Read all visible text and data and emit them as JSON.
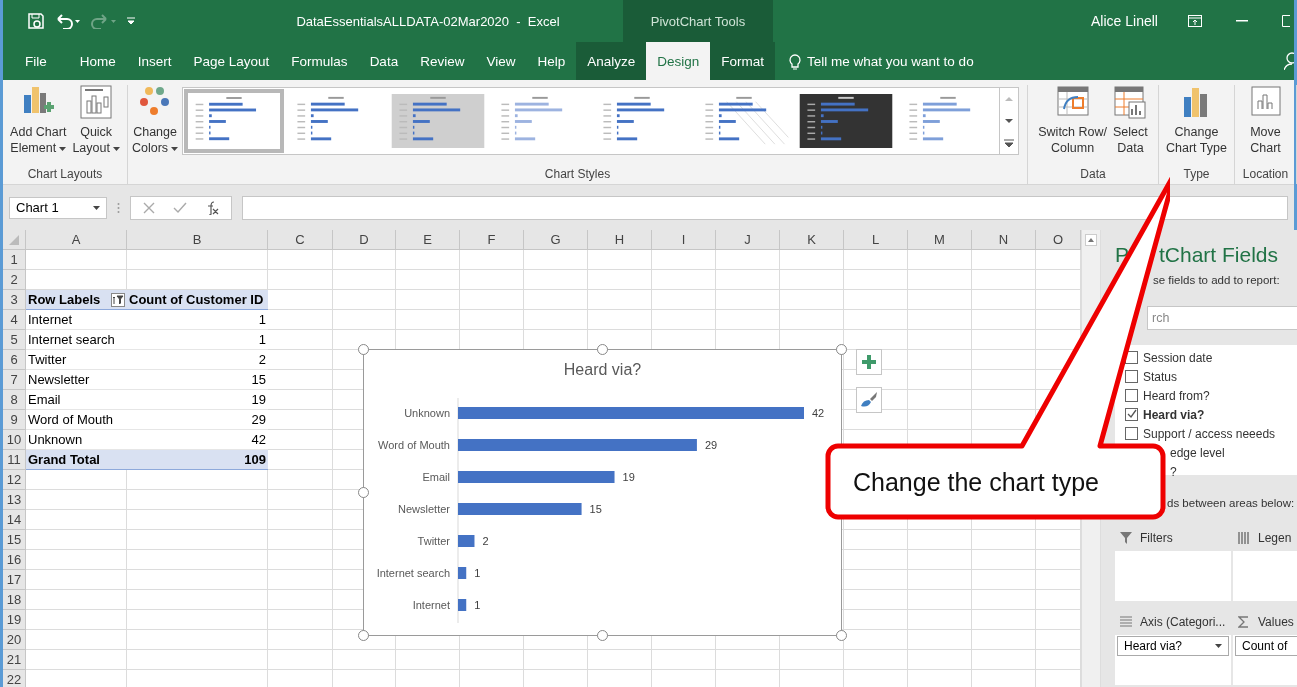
{
  "window": {
    "title": "DataEssentialsALLDATA-02Mar2020  -  Excel",
    "context_title": "PivotChart Tools",
    "user": "Alice Linell"
  },
  "tabs": [
    {
      "label": "File",
      "selected": false,
      "contextual": false
    },
    {
      "label": "Home",
      "selected": false,
      "contextual": false
    },
    {
      "label": "Insert",
      "selected": false,
      "contextual": false
    },
    {
      "label": "Page Layout",
      "selected": false,
      "contextual": false
    },
    {
      "label": "Formulas",
      "selected": false,
      "contextual": false
    },
    {
      "label": "Data",
      "selected": false,
      "contextual": false
    },
    {
      "label": "Review",
      "selected": false,
      "contextual": false
    },
    {
      "label": "View",
      "selected": false,
      "contextual": false
    },
    {
      "label": "Help",
      "selected": false,
      "contextual": false
    },
    {
      "label": "Analyze",
      "selected": false,
      "contextual": true
    },
    {
      "label": "Design",
      "selected": true,
      "contextual": true
    },
    {
      "label": "Format",
      "selected": false,
      "contextual": true
    }
  ],
  "tell_me": {
    "placeholder": "Tell me what you want to do"
  },
  "ribbon": {
    "left_groups": [
      {
        "label": "Chart Layouts",
        "buttons": [
          {
            "label": "Add Chart\nElement",
            "kind": "add-element",
            "dropdown": true
          },
          {
            "label": "Quick\nLayout",
            "kind": "quick-layout",
            "dropdown": true
          }
        ]
      }
    ],
    "styles_group": {
      "label": "Chart Styles",
      "colors_button": {
        "label": "Change\nColors",
        "kind": "colors",
        "dropdown": true
      },
      "styles": [
        {
          "kind": "plain",
          "selected": true
        },
        {
          "kind": "dotted",
          "selected": false
        },
        {
          "kind": "shaded",
          "selected": false
        },
        {
          "kind": "pale",
          "selected": false
        },
        {
          "kind": "plain",
          "selected": false
        },
        {
          "kind": "hatched",
          "selected": false
        },
        {
          "kind": "dark",
          "selected": false
        },
        {
          "kind": "faded",
          "selected": false
        }
      ]
    },
    "right_groups": [
      {
        "label": "Data",
        "buttons": [
          {
            "label": "Switch Row/\nColumn",
            "kind": "switch",
            "dropdown": false
          },
          {
            "label": "Select\nData",
            "kind": "select-data",
            "dropdown": false
          }
        ]
      },
      {
        "label": "Type",
        "buttons": [
          {
            "label": "Change\nChart Type",
            "kind": "change-type",
            "dropdown": false
          }
        ]
      },
      {
        "label": "Location",
        "buttons": [
          {
            "label": "Move\nChart",
            "kind": "move",
            "dropdown": false
          }
        ]
      }
    ]
  },
  "formula_bar": {
    "name_box": "Chart 1"
  },
  "sheet": {
    "columns": [
      "A",
      "B",
      "C",
      "D",
      "E",
      "F",
      "G",
      "H",
      "I",
      "J",
      "K",
      "L",
      "M",
      "N",
      "O"
    ],
    "rows": [
      "1",
      "2",
      "3",
      "4",
      "5",
      "6",
      "7",
      "8",
      "9",
      "10",
      "11",
      "12",
      "13",
      "14",
      "15",
      "16",
      "17",
      "18",
      "19",
      "20",
      "21",
      "22"
    ],
    "pivot": {
      "header": [
        "Row Labels",
        "Count of Customer ID"
      ],
      "rows": [
        {
          "label": "Internet",
          "count": "1"
        },
        {
          "label": "Internet search",
          "count": "1"
        },
        {
          "label": "Twitter",
          "count": "2"
        },
        {
          "label": "Newsletter",
          "count": "15"
        },
        {
          "label": "Email",
          "count": "19"
        },
        {
          "label": "Word of Mouth",
          "count": "29"
        },
        {
          "label": "Unknown",
          "count": "42"
        }
      ],
      "total": {
        "label": "Grand Total",
        "count": "109"
      }
    }
  },
  "chart": {
    "chart_data": {
      "type": "bar",
      "orientation": "horizontal",
      "title": "Heard via?",
      "categories": [
        "Unknown",
        "Word of Mouth",
        "Email",
        "Newsletter",
        "Twitter",
        "Internet search",
        "Internet"
      ],
      "values": [
        42,
        29,
        19,
        15,
        2,
        1,
        1
      ],
      "data_labels": true
    }
  },
  "pane": {
    "title_start": "P",
    "title_end": "tChart Fields",
    "subtitle": "se fields to add to report:",
    "search": {
      "placeholder": "rch"
    },
    "fields": [
      {
        "label": "Session date",
        "checked": false
      },
      {
        "label": "Status",
        "checked": false
      },
      {
        "label": "Heard from?",
        "checked": false
      },
      {
        "label": "Heard via?",
        "checked": true
      },
      {
        "label": "Support / access neeeds",
        "checked": false
      }
    ],
    "covered_fields": [
      "edge level",
      "?"
    ],
    "drag_hint": "ds between areas below:",
    "areas": [
      {
        "label": "Filters",
        "kind": "filters"
      },
      {
        "label": "Legen",
        "kind": "legend"
      },
      {
        "label": "Axis (Categori...",
        "kind": "axis",
        "item": "Heard via?"
      },
      {
        "label": "Values",
        "kind": "values",
        "item": "Count of"
      }
    ]
  },
  "callout": {
    "text": "Change the chart type"
  }
}
